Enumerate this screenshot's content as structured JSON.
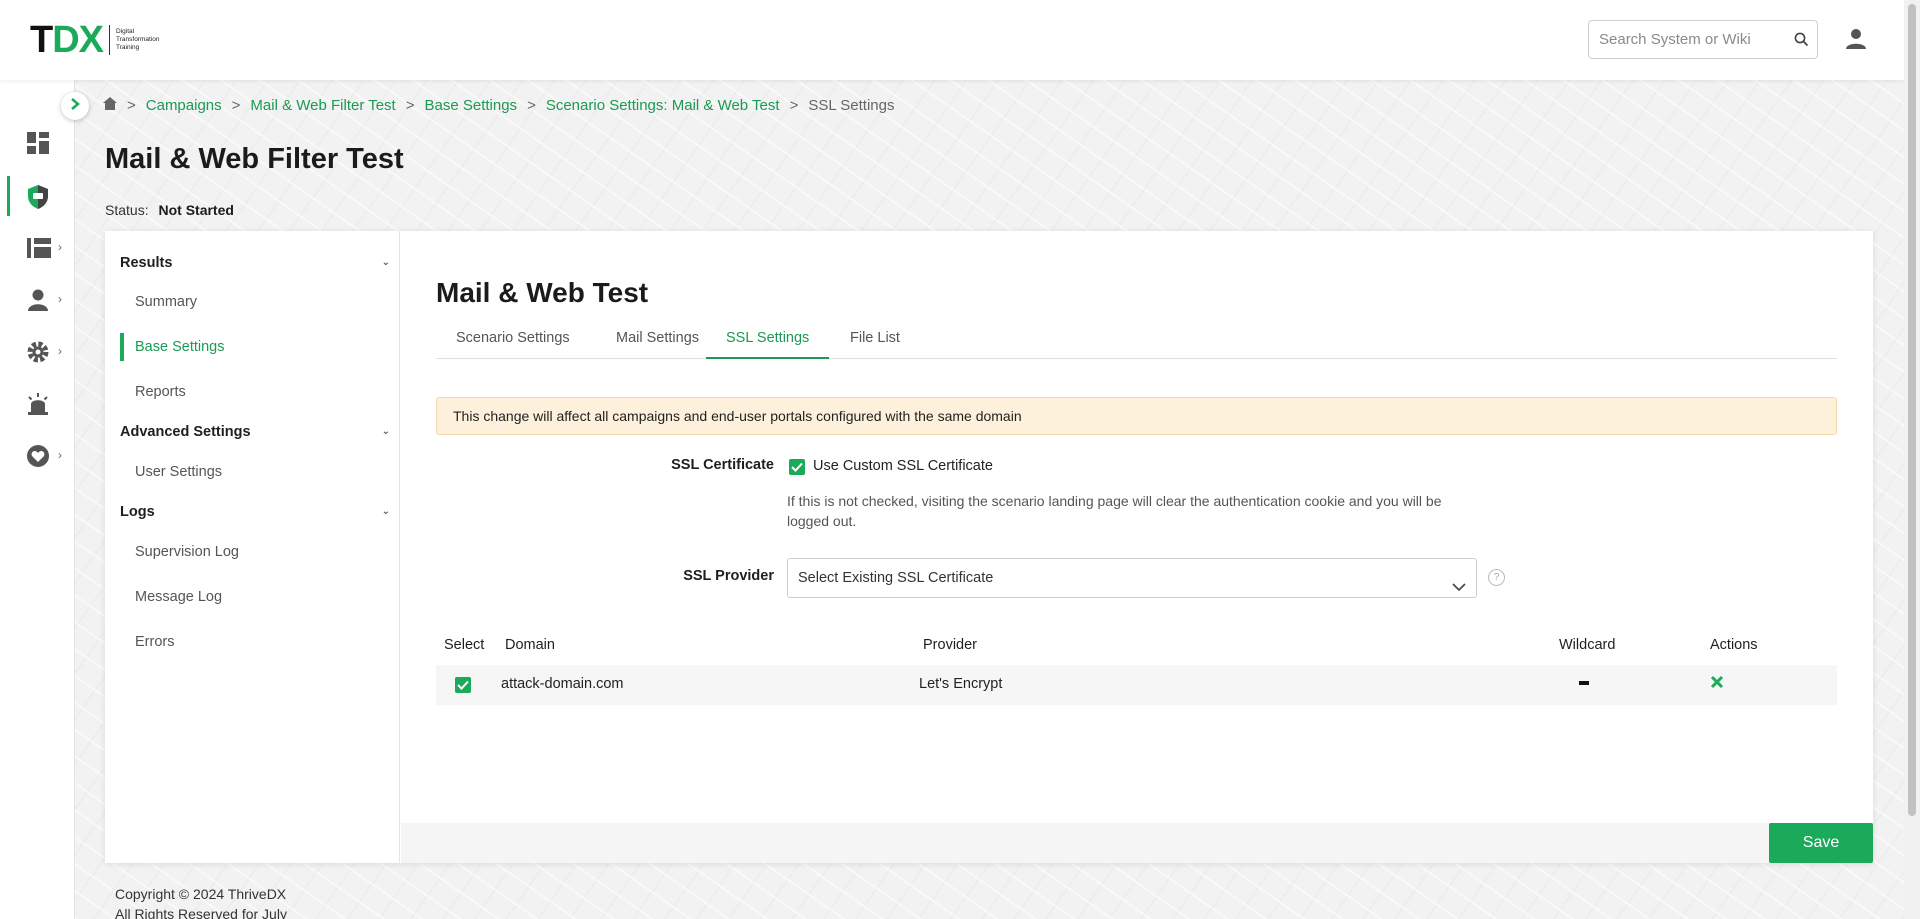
{
  "header": {
    "logo_main": "TDX",
    "logo_sub_lines": [
      "Digital",
      "Transformation",
      "Training"
    ],
    "search_placeholder": "Search System or Wiki"
  },
  "breadcrumb": {
    "items": [
      "Campaigns",
      "Mail & Web Filter Test",
      "Base Settings",
      "Scenario Settings: Mail & Web Test"
    ],
    "current": "SSL Settings",
    "separator": ">"
  },
  "page": {
    "title": "Mail & Web Filter Test",
    "status_label": "Status:",
    "status_value": "Not Started"
  },
  "sidemenu": {
    "results": {
      "label": "Results",
      "items": [
        "Summary",
        "Base Settings",
        "Reports"
      ]
    },
    "advanced": {
      "label": "Advanced Settings",
      "items": [
        "User Settings"
      ]
    },
    "logs": {
      "label": "Logs",
      "items": [
        "Supervision Log",
        "Message Log",
        "Errors"
      ]
    },
    "active_item": "Base Settings"
  },
  "content": {
    "title": "Mail & Web Test",
    "tabs": [
      "Scenario Settings",
      "Mail Settings",
      "SSL Settings",
      "File List"
    ],
    "active_tab": "SSL Settings",
    "alert": "This change will affect all campaigns and end-user portals configured with the same domain",
    "ssl_certificate": {
      "label": "SSL Certificate",
      "checkbox_label": "Use Custom SSL Certificate",
      "checked": true,
      "help": "If this is not checked, visiting the scenario landing page will clear the authentication cookie and you will be logged out."
    },
    "ssl_provider": {
      "label": "SSL Provider",
      "selected": "Select Existing SSL Certificate",
      "help_icon": "?"
    },
    "table": {
      "headers": [
        "Select",
        "Domain",
        "Provider",
        "Wildcard",
        "Actions"
      ],
      "rows": [
        {
          "selected": true,
          "domain": "attack-domain.com",
          "provider": "Let's Encrypt",
          "wildcard": "—",
          "action_icon": "close-icon"
        }
      ]
    },
    "save_label": "Save"
  },
  "footer": {
    "line1": "Copyright © 2024 ThriveDX",
    "line2": "All Rights Reserved for July"
  },
  "colors": {
    "brand_green": "#1aaa5a",
    "alert_bg": "#fdf1dc"
  },
  "rail_icons": [
    "dashboard-icon",
    "shield-icon",
    "campaigns-icon",
    "users-icon",
    "settings-icon",
    "alert-icon",
    "heart-icon"
  ]
}
